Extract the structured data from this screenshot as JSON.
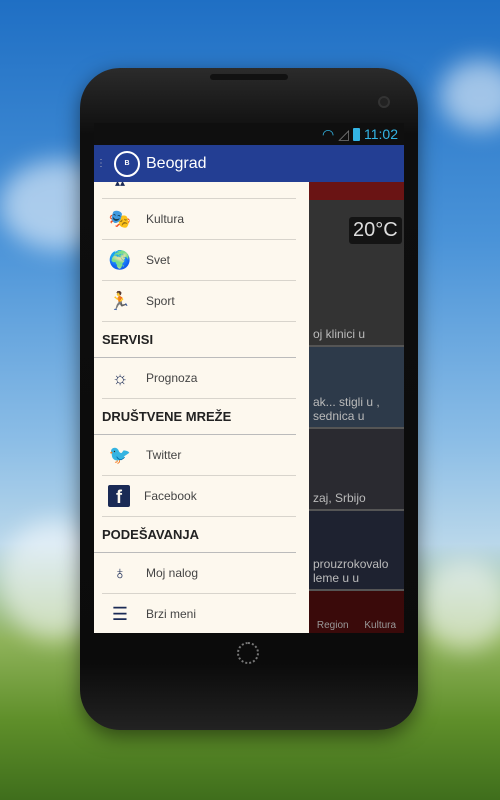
{
  "status": {
    "time": "11:02",
    "icons": [
      "wifi-icon",
      "signal-icon",
      "battery-icon"
    ]
  },
  "actionbar": {
    "title": "Beograd",
    "logo_text": "studio B"
  },
  "background_content": {
    "temperature": "20°C",
    "cards": [
      "oj klinici u",
      "ak... stigli u , sednica u",
      "zaj, Srbijo",
      "prouzrokovalo leme u u"
    ],
    "bottom_nav": [
      "Region",
      "Kultura"
    ]
  },
  "drawer": {
    "items_top": [
      {
        "label": "Kultura",
        "icon": "theater-masks-icon"
      },
      {
        "label": "Svet",
        "icon": "globe-icon"
      },
      {
        "label": "Sport",
        "icon": "running-icon"
      }
    ],
    "sections": [
      {
        "title": "SERVISI",
        "items": [
          {
            "label": "Prognoza",
            "icon": "sun-icon"
          }
        ]
      },
      {
        "title": "DRUŠTVENE MREŽE",
        "items": [
          {
            "label": "Twitter",
            "icon": "twitter-icon"
          },
          {
            "label": "Facebook",
            "icon": "facebook-icon"
          }
        ]
      },
      {
        "title": "PODEŠAVANJA",
        "items": [
          {
            "label": "Moj nalog",
            "icon": "user-icon"
          },
          {
            "label": "Brzi meni",
            "icon": "menu-icon"
          }
        ]
      }
    ]
  },
  "colors": {
    "actionbar": "#233e93",
    "drawer_bg": "#fdf8ee",
    "status_accent": "#33b5e5"
  }
}
